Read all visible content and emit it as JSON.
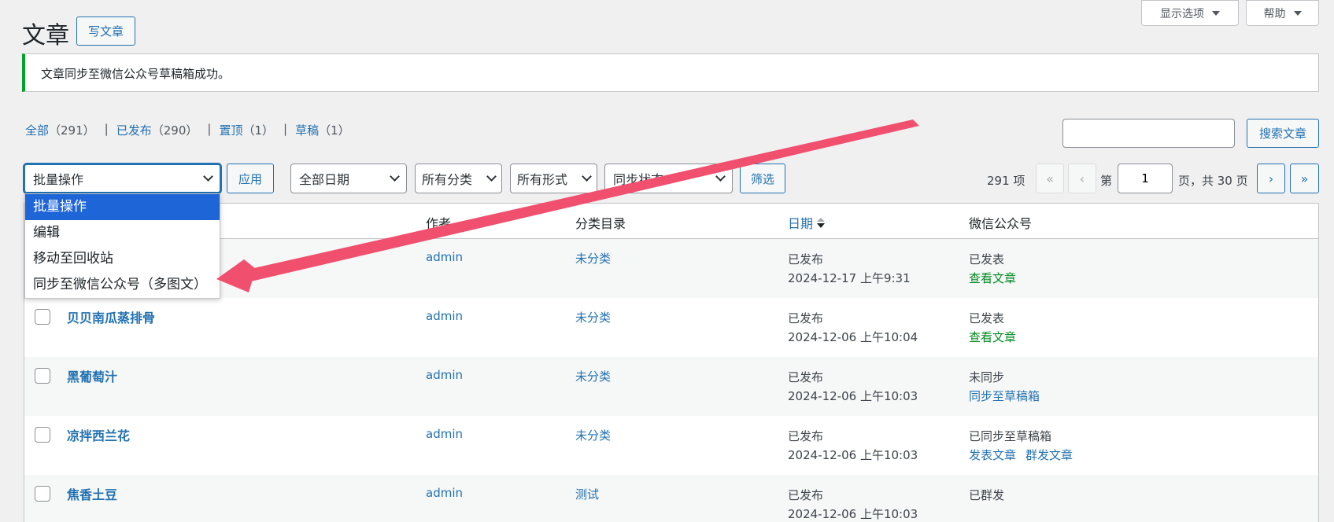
{
  "header": {
    "title": "文章",
    "add_new": "写文章",
    "screen_options": "显示选项",
    "help": "帮助"
  },
  "notice": "文章同步至微信公众号草稿箱成功。",
  "views": [
    {
      "label": "全部",
      "count": "（291）"
    },
    {
      "label": "已发布",
      "count": "（290）"
    },
    {
      "label": "置顶",
      "count": "（1）"
    },
    {
      "label": "草稿",
      "count": "（1）"
    }
  ],
  "search": {
    "value": "",
    "button": "搜索文章"
  },
  "filters": {
    "bulk_action": "批量操作",
    "apply": "应用",
    "date": "全部日期",
    "category": "所有分类",
    "format": "所有形式",
    "sync_status": "同步状态",
    "filter": "筛选"
  },
  "bulk_options": [
    "批量操作",
    "编辑",
    "移动至回收站",
    "同步至微信公众号（多图文）"
  ],
  "pagination": {
    "total": "291 项",
    "first": "«",
    "prev": "‹",
    "page_prefix": "第",
    "current": "1",
    "page_suffix": "页，共 30 页",
    "next": "›",
    "last": "»"
  },
  "columns": {
    "author": "作者",
    "category": "分类目录",
    "date": "日期",
    "wechat": "微信公众号"
  },
  "rows": [
    {
      "title": "",
      "author": "admin",
      "category": "未分类",
      "status": "已发布",
      "date": "2024-12-17 上午9:31",
      "wx_status": "已发表",
      "wx_links": [
        "查看文章"
      ]
    },
    {
      "title": "贝贝南瓜蒸排骨",
      "author": "admin",
      "category": "未分类",
      "status": "已发布",
      "date": "2024-12-06 上午10:04",
      "wx_status": "已发表",
      "wx_links": [
        "查看文章"
      ]
    },
    {
      "title": "黑葡萄汁",
      "author": "admin",
      "category": "未分类",
      "status": "已发布",
      "date": "2024-12-06 上午10:03",
      "wx_status": "未同步",
      "wx_links": [
        "同步至草稿箱"
      ]
    },
    {
      "title": "凉拌西兰花",
      "author": "admin",
      "category": "未分类",
      "status": "已发布",
      "date": "2024-12-06 上午10:03",
      "wx_status": "已同步至草稿箱",
      "wx_links": [
        "发表文章",
        "群发文章"
      ]
    },
    {
      "title": "焦香土豆",
      "author": "admin",
      "category": "测试",
      "status": "已发布",
      "date": "2024-12-06 上午10:03",
      "wx_status": "已群发",
      "wx_links": []
    }
  ],
  "colors": {
    "accent": "#2271b1",
    "success": "#00a32a",
    "arrow": "#f0506e",
    "highlight": "#1e65d8"
  }
}
